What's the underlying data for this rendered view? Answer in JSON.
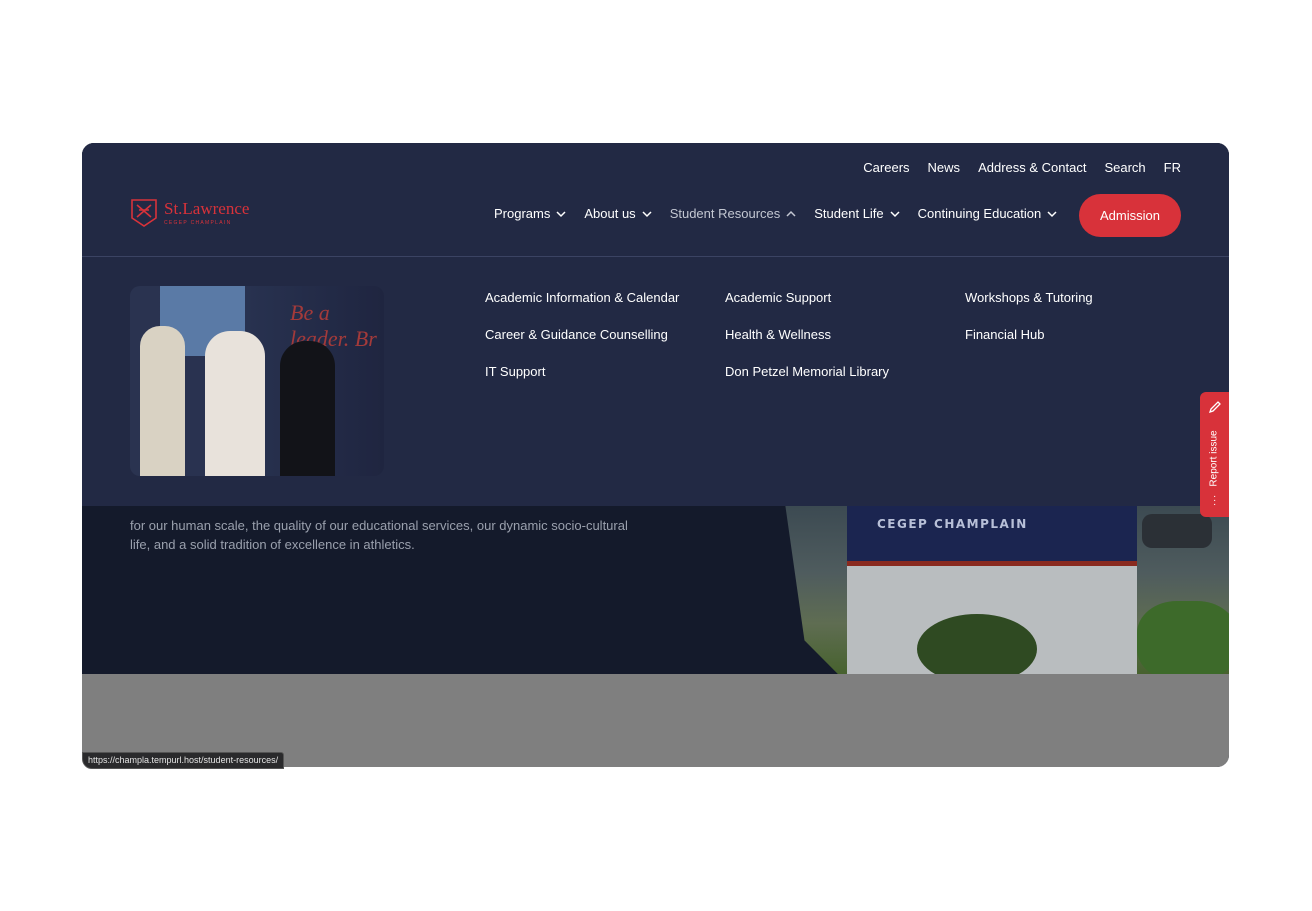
{
  "utility_nav": [
    "Careers",
    "News",
    "Address & Contact",
    "Search",
    "FR"
  ],
  "logo": {
    "name": "St.Lawrence",
    "sub": "CEGEP CHAMPLAIN"
  },
  "main_nav": [
    {
      "label": "Programs",
      "active": false
    },
    {
      "label": "About us",
      "active": false
    },
    {
      "label": "Student Resources",
      "active": true
    },
    {
      "label": "Student Life",
      "active": false
    },
    {
      "label": "Continuing Education",
      "active": false
    }
  ],
  "admission_label": "Admission",
  "menu_image_text": "Be a leader. Br",
  "menu_links": {
    "col1": [
      "Academic Information & Calendar",
      "Career & Guidance Counselling",
      "IT Support"
    ],
    "col2": [
      "Academic Support",
      "Health & Wellness",
      "Don Petzel Memorial Library"
    ],
    "col3": [
      "Workshops & Tutoring",
      "Financial Hub"
    ]
  },
  "hero": {
    "text": "for our human scale, the quality of our educational services, our dynamic socio-cultural life, and a solid tradition of excellence in athletics.",
    "sign_text": "CEGEP CHAMPLAIN"
  },
  "report_issue_label": "Report issue",
  "status_url": "https://champla.tempurl.host/student-resources/",
  "colors": {
    "navy": "#222944",
    "accent_red": "#d8323a",
    "hero_bg": "#141a2b"
  }
}
